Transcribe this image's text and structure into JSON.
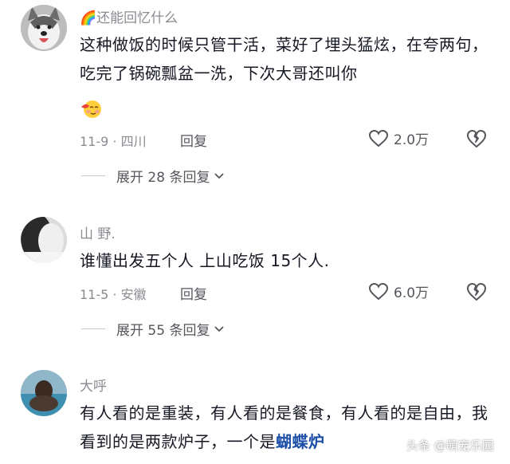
{
  "comments": [
    {
      "author": "🌈还能回忆什么",
      "text": "这种做饭的时候只管干活，菜好了埋头猛炫，在夸两句，吃完了锅碗瓢盆一洗，下次大哥还叫你",
      "meta": "11-9 · 四川",
      "reply": "回复",
      "likes": "2.0万",
      "expand": "展开 28 条回复"
    },
    {
      "author": "山 野.",
      "text": "谁懂出发五个人 上山吃饭 15个人.",
      "meta": "11-5 · 安徽",
      "reply": "回复",
      "likes": "6.0万",
      "expand": "展开 55 条回复"
    },
    {
      "author": "大呼",
      "text_a": "有人看的是重装，有人看的是餐食，有人看的是自由，我看到的是两款炉子，一个是",
      "text_b": "蝴蝶炉"
    }
  ],
  "watermark": "头条 @萌宠乐园",
  "icons": {
    "like": "heart-outline-icon",
    "dislike": "broken-heart-icon",
    "expand": "chevron-down-icon",
    "emoji": "blushing-face-emoji"
  }
}
